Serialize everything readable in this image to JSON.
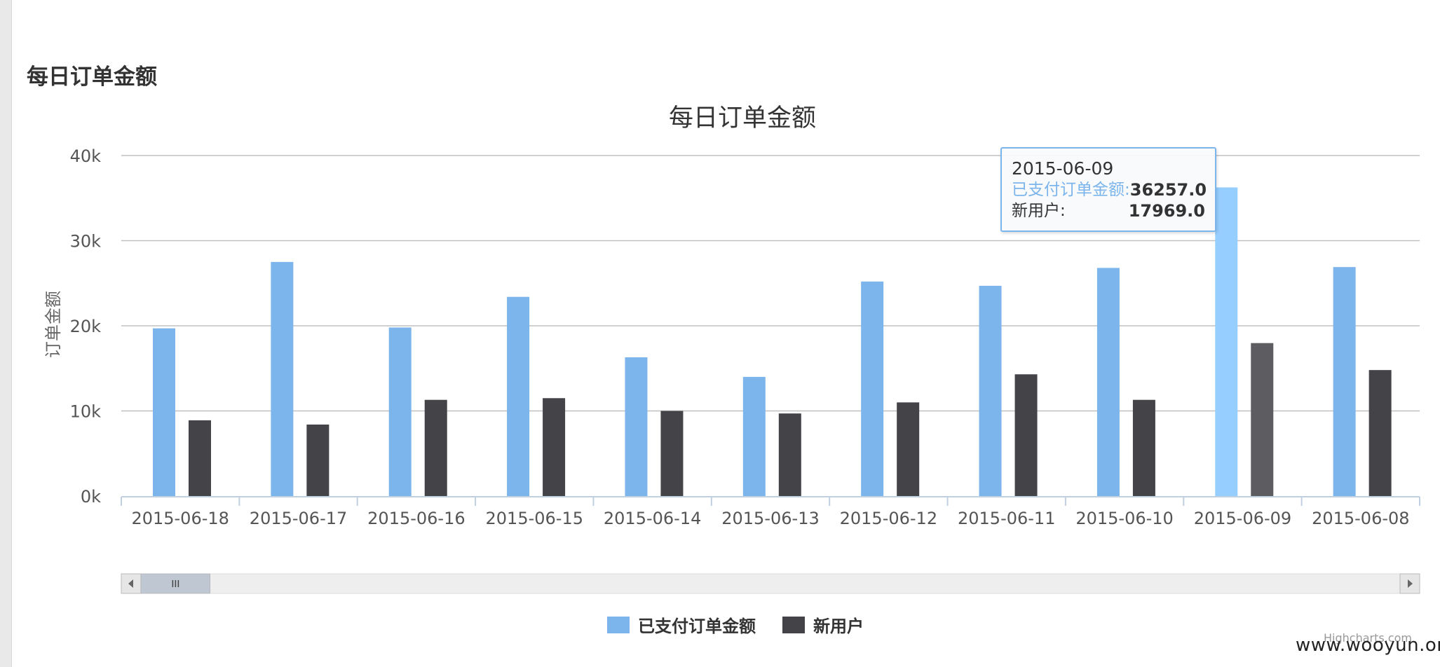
{
  "section_title": "每日订单金额",
  "chart_data": {
    "type": "bar",
    "title": "每日订单金额",
    "xlabel": "",
    "ylabel": "订单金额",
    "ylim": [
      0,
      40000
    ],
    "yticks": [
      "0k",
      "10k",
      "20k",
      "30k",
      "40k"
    ],
    "categories": [
      "2015-06-18",
      "2015-06-17",
      "2015-06-16",
      "2015-06-15",
      "2015-06-14",
      "2015-06-13",
      "2015-06-12",
      "2015-06-11",
      "2015-06-10",
      "2015-06-09",
      "2015-06-08"
    ],
    "series": [
      {
        "name": "已支付订单金额",
        "color": "#7cb5ec",
        "hover_color": "#95ceff",
        "values": [
          19700,
          27500,
          19800,
          23400,
          16300,
          14000,
          25200,
          24700,
          26800,
          36257,
          26900
        ]
      },
      {
        "name": "新用户",
        "color": "#434348",
        "hover_color": "#5c5c61",
        "values": [
          8900,
          8400,
          11300,
          11500,
          10000,
          9700,
          11000,
          14300,
          11300,
          17969,
          14800
        ]
      }
    ],
    "grid": true,
    "legend_position": "bottom-center",
    "highlighted_category": "2015-06-09",
    "scrollbar": {
      "visible": true,
      "thumb_fraction": 0.055
    }
  },
  "tooltip": {
    "date": "2015-06-09",
    "rows": [
      {
        "label": "已支付订单金额:",
        "value": "36257.0",
        "color": "#7cb5ec"
      },
      {
        "label": "新用户:",
        "value": "17969.0",
        "color": "#333333"
      }
    ]
  },
  "credits": "Highcharts.com",
  "watermark": "www.wooyun.org",
  "icons": {
    "scroll_left": "triangle-left-icon",
    "scroll_right": "triangle-right-icon",
    "scroll_grip": "grip-icon"
  }
}
